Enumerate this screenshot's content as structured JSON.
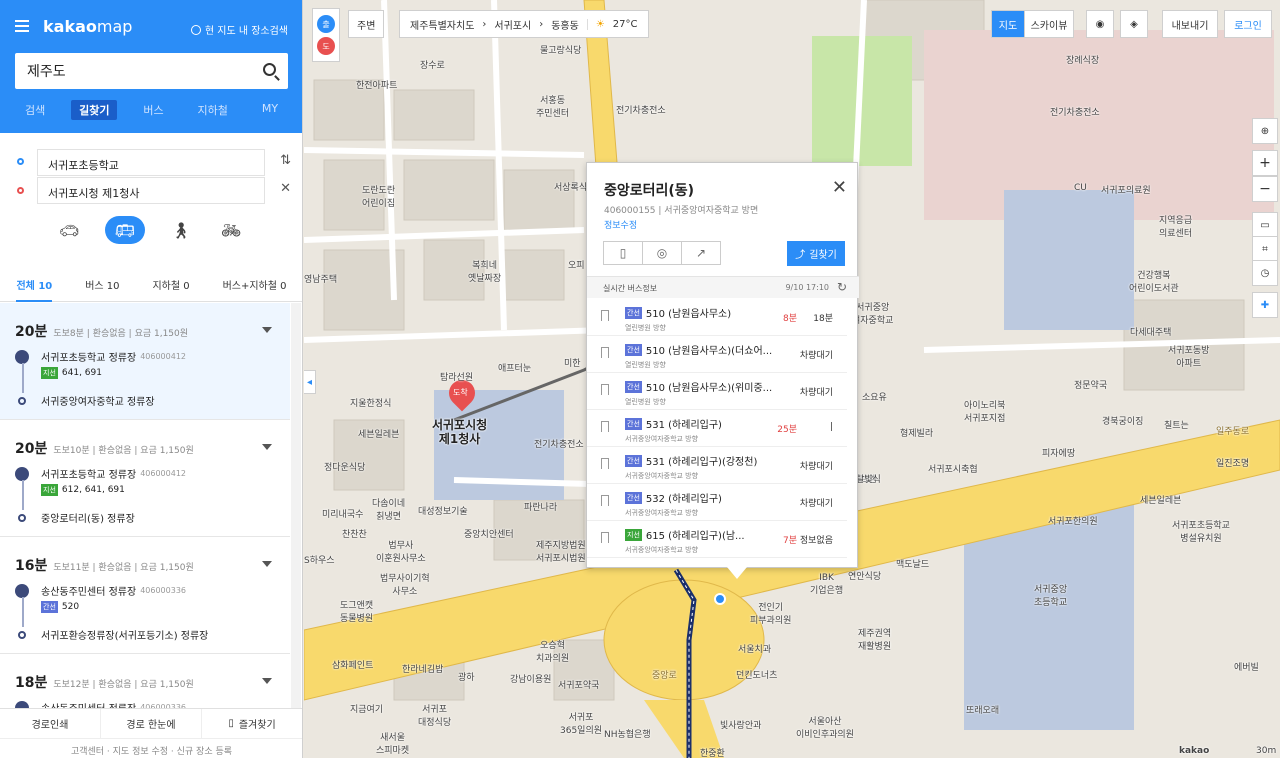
{
  "sidebar": {
    "logo": "kakao",
    "logo2": "map",
    "nearby": "현 지도 내 장소검색",
    "search_value": "제주도",
    "tabs": [
      "검색",
      "길찾기",
      "버스",
      "지하철",
      "MY"
    ],
    "active_tab": "길찾기",
    "origin": "서귀포초등학교",
    "destination": "서귀포시청 제1청사",
    "modes": [
      "car-icon",
      "bus-icon",
      "walk-icon",
      "bike-icon"
    ],
    "route_tabs": [
      "전체 10",
      "버스 10",
      "지하철 0",
      "버스+지하철 0"
    ],
    "routes": [
      {
        "time": "20분",
        "meta": "도보8분 | 환승없음 | 요금 1,150원",
        "start": "서귀포초등학교 정류장",
        "start_id": "406000412",
        "tag": "지선",
        "lines": "641, 691",
        "end": "서귀중앙여자중학교 정류장"
      },
      {
        "time": "20분",
        "meta": "도보10분 | 환승없음 | 요금 1,150원",
        "start": "서귀포초등학교 정류장",
        "start_id": "406000412",
        "tag": "지선",
        "lines": "612, 641, 691",
        "end": "중앙로터리(동) 정류장"
      },
      {
        "time": "16분",
        "meta": "도보11분 | 환승없음 | 요금 1,150원",
        "start": "송산동주민센터 정류장",
        "start_id": "406000336",
        "tag": "간선",
        "lines": "520",
        "end": "서귀포환승정류장(서귀포등기소) 정류장"
      },
      {
        "time": "18분",
        "meta": "도보12분 | 환승없음 | 요금 1,150원",
        "start": "송산동주민센터 정류장",
        "start_id": "406000336",
        "tag": "",
        "lines": "",
        "end": ""
      }
    ],
    "footer": [
      "경로인쇄",
      "경로 한눈에",
      "즐겨찾기"
    ],
    "footer2": "고객센터 · 지도 정보 수정 · 신규 장소 등록"
  },
  "map": {
    "near_btn": "주변",
    "breadcrumb": [
      "제주특별자치도",
      "서귀포시",
      "동홍동"
    ],
    "weather": "27°C",
    "view_btns": [
      "지도",
      "스카이뷰"
    ],
    "export": "내보내기",
    "login": "로그인",
    "start_pin": "출",
    "end_pin": "도",
    "dest_marker": "도착",
    "dest_label": "서귀포시청\n제1청사",
    "labels": [
      {
        "t": "물고랑식당"
      },
      {
        "t": "장수로"
      },
      {
        "t": "한전아파트"
      },
      {
        "t": "서홍동\n주민센터"
      },
      {
        "t": "전기차충전소"
      },
      {
        "t": "장례식장"
      },
      {
        "t": "전기차충전소"
      },
      {
        "t": "서귀포의료원"
      },
      {
        "t": "지역응급\n의료센터"
      },
      {
        "t": "건강행복\n어린이도서관"
      },
      {
        "t": "도란도란\n어린이집"
      },
      {
        "t": "서상록식"
      },
      {
        "t": "영남주택"
      },
      {
        "t": "복희네\n옛날짜장"
      },
      {
        "t": "오피"
      },
      {
        "t": "탐라선원"
      },
      {
        "t": "애프터눈"
      },
      {
        "t": "미한"
      },
      {
        "t": "지울한정식"
      },
      {
        "t": "세븐일레븐"
      },
      {
        "t": "정다운식당"
      },
      {
        "t": "전기차충전소"
      },
      {
        "t": "다솜이네\n칡냉면"
      },
      {
        "t": "대성정보기술"
      },
      {
        "t": "미리내국수"
      },
      {
        "t": "찬찬찬"
      },
      {
        "t": "중앙치안센터"
      },
      {
        "t": "파란나라"
      },
      {
        "t": "법무사\n이훈원사무소"
      },
      {
        "t": "제주지방법원\n서귀포시법원"
      },
      {
        "t": "법무사이기혁\n사무소"
      },
      {
        "t": "도그앤캣\n동물병원"
      },
      {
        "t": "삼화페인트"
      },
      {
        "t": "한라네김밥"
      },
      {
        "t": "오승혁\n치과의원"
      },
      {
        "t": "광하"
      },
      {
        "t": "강남이용원"
      },
      {
        "t": "서귀포약국"
      },
      {
        "t": "지금여기"
      },
      {
        "t": "서귀포\n대정식당"
      },
      {
        "t": "새서울\n스피마켓"
      },
      {
        "t": "서귀포\n365일의원"
      },
      {
        "t": "NH농협은행"
      },
      {
        "t": "빛사랑안과"
      },
      {
        "t": "한중환"
      },
      {
        "t": "서울아산\n이비인후과의원"
      },
      {
        "t": "던킨도너츠"
      },
      {
        "t": "서울치과"
      },
      {
        "t": "전인기\n피부과의원"
      },
      {
        "t": "IBK\n기업은행"
      },
      {
        "t": "연안식당"
      },
      {
        "t": "제주권역\n재활병원"
      },
      {
        "t": "서귀포시축협"
      },
      {
        "t": "리브엠"
      },
      {
        "t": "형제빌라"
      },
      {
        "t": "소요유"
      },
      {
        "t": "다세대주택"
      },
      {
        "t": "서귀중앙\n여자중학교"
      },
      {
        "t": "정문약국"
      },
      {
        "t": "아이노리북\n서귀포지점"
      },
      {
        "t": "경북궁이징"
      },
      {
        "t": "칠트는"
      },
      {
        "t": "피자에땅"
      },
      {
        "t": "일진조명"
      },
      {
        "t": "세븐일레븐"
      },
      {
        "t": "서귀포한의원"
      },
      {
        "t": "서귀포초등학교\n병설유치원"
      },
      {
        "t": "맥도날드"
      },
      {
        "t": "서귀중앙\n초등학교"
      },
      {
        "t": "또래오래"
      },
      {
        "t": "에버빌"
      },
      {
        "t": "서귀포동방\n아파트"
      },
      {
        "t": "일주동로"
      },
      {
        "t": "중앙로"
      },
      {
        "t": "CU"
      },
      {
        "t": "탈빛식"
      },
      {
        "t": "S하우스"
      }
    ],
    "scale": "30m",
    "kakao": "kakao"
  },
  "popup": {
    "title": "중앙로터리(동)",
    "sub": "406000155 | 서귀중앙여자중학교 방면",
    "edit": "정보수정",
    "find": "길찾기",
    "rt_label": "실시간 버스정보",
    "rt_time": "9/10 17:10",
    "rows": [
      {
        "tag": "간선",
        "name": "510 (남원읍사무소)",
        "dir": "열린병원 방향",
        "min": "8분",
        "status": "18분"
      },
      {
        "tag": "간선",
        "name": "510 (남원읍사무소)(더쇼어...",
        "dir": "열린병원 방향",
        "min": "",
        "status": "차량대기"
      },
      {
        "tag": "간선",
        "name": "510 (남원읍사무소)(위미중...",
        "dir": "열린병원 방향",
        "min": "",
        "status": "차량대기"
      },
      {
        "tag": "간선",
        "name": "531 (하례리입구)",
        "dir": "서귀중앙여자중학교 방향",
        "min": "25분",
        "status": "|"
      },
      {
        "tag": "간선",
        "name": "531 (하례리입구)(강정천)",
        "dir": "서귀중앙여자중학교 방향",
        "min": "",
        "status": "차량대기"
      },
      {
        "tag": "간선",
        "name": "532 (하례리입구)",
        "dir": "서귀중앙여자중학교 방향",
        "min": "",
        "status": "차량대기"
      },
      {
        "tag": "지선",
        "name": "615 (하례리입구)(남...",
        "dir": "서귀중앙여자중학교 방향",
        "min": "7분",
        "status": "정보없음"
      }
    ]
  },
  "colors": {
    "accent": "#2b8df7",
    "route": "#1b2f6b",
    "road": "#f8d96c"
  }
}
